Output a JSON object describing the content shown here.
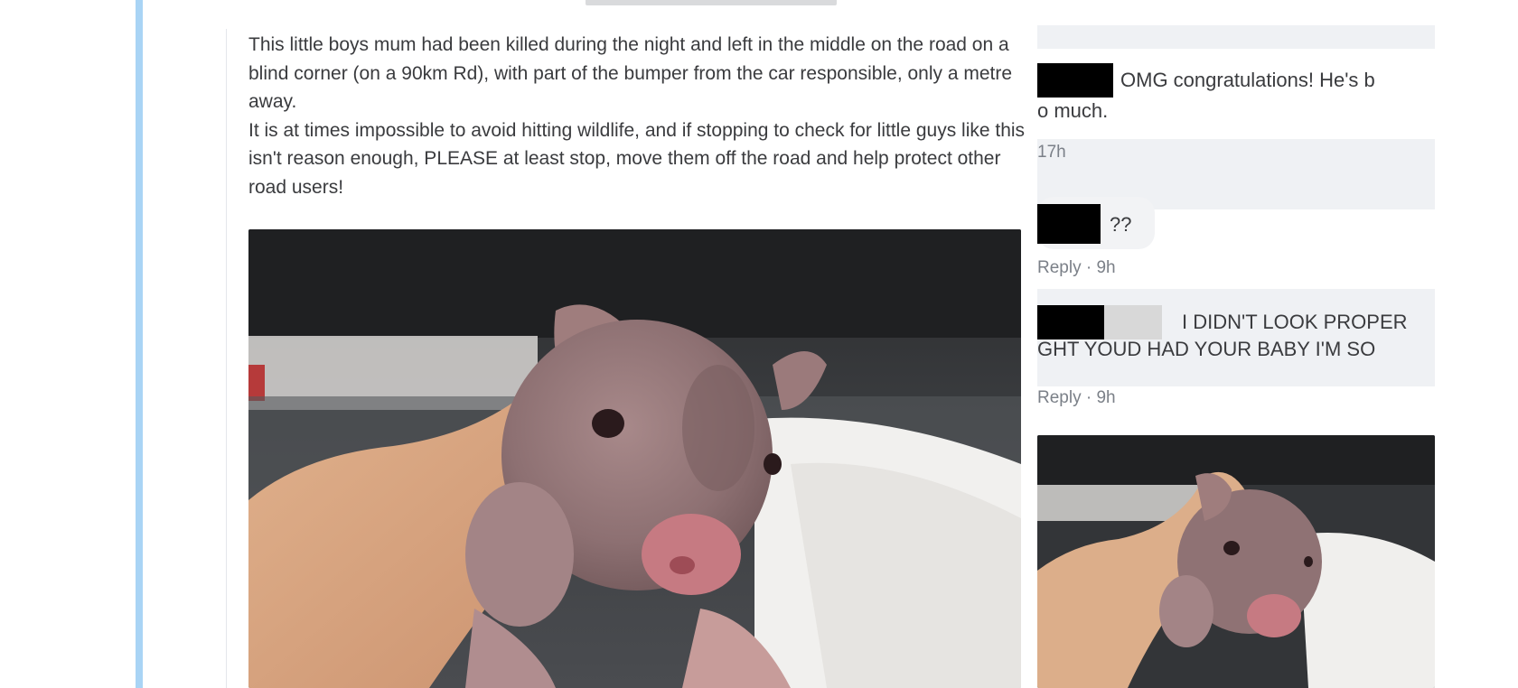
{
  "post": {
    "paragraph1": "This little boys mum had been killed during the night and left in the middle on the road on a blind corner (on a 90km Rd), with part of the bumper from the car responsible, only a metre away.",
    "paragraph2": "It is at times impossible to avoid hitting wildlife, and if stopping to check for little guys like this isn't reason enough, PLEASE at least stop, move them off the road and help protect other road users!"
  },
  "comments": [
    {
      "line1": "OMG congratulations! He's b",
      "line2": "o much."
    },
    {
      "meta": "17h"
    },
    {
      "text": "??",
      "meta": "Reply · 9h"
    },
    {
      "line1": "I DIDN'T LOOK PROPER",
      "line2": "GHT YOUD HAD YOUR BABY I'M SO",
      "meta": "Reply · 9h"
    }
  ],
  "colors": {
    "accent_bar": "#a9d4f5",
    "comment_bg": "#eff1f4",
    "redaction": "#000000"
  }
}
